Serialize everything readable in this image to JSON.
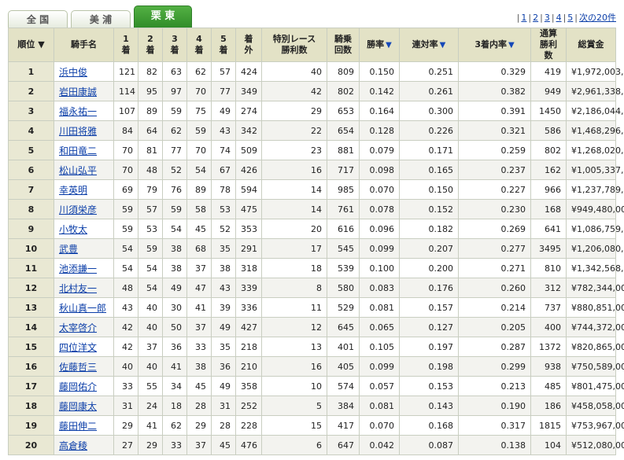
{
  "tabs": [
    {
      "label": "全 国",
      "active": false
    },
    {
      "label": "美 浦",
      "active": false
    },
    {
      "label": "栗 東",
      "active": true
    }
  ],
  "pager": {
    "pages": [
      "1",
      "2",
      "3",
      "4",
      "5"
    ],
    "next_label": "次の20件"
  },
  "colors": {
    "header_bg": "#e3e2c6",
    "tab_active": "#3a9a31",
    "link": "#0b3ea8"
  },
  "table": {
    "headers": {
      "rank": "順位",
      "name": "騎手名",
      "first": "1着",
      "second": "2着",
      "third": "3着",
      "fourth": "4着",
      "fifth": "5着",
      "out": "着外",
      "special_1": "特別レース",
      "special_2": "勝利数",
      "rides_1": "騎乗",
      "rides_2": "回数",
      "win_rate": "勝率",
      "quinella_rate": "連対率",
      "top3_rate": "3着内率",
      "career_1": "通算",
      "career_2": "勝利数",
      "prize": "総賞金"
    },
    "sort_marker": "▼",
    "rows": [
      {
        "rank": "1",
        "name": "浜中俊",
        "first": "121",
        "second": "82",
        "third": "63",
        "fourth": "62",
        "fifth": "57",
        "out": "424",
        "special": "40",
        "rides": "809",
        "win_rate": "0.150",
        "quinella_rate": "0.251",
        "top3_rate": "0.329",
        "career": "419",
        "prize": "¥1,972,003,000"
      },
      {
        "rank": "2",
        "name": "岩田康誠",
        "first": "114",
        "second": "95",
        "third": "97",
        "fourth": "70",
        "fifth": "77",
        "out": "349",
        "special": "42",
        "rides": "802",
        "win_rate": "0.142",
        "quinella_rate": "0.261",
        "top3_rate": "0.382",
        "career": "949",
        "prize": "¥2,961,338,000"
      },
      {
        "rank": "3",
        "name": "福永祐一",
        "first": "107",
        "second": "89",
        "third": "59",
        "fourth": "75",
        "fifth": "49",
        "out": "274",
        "special": "29",
        "rides": "653",
        "win_rate": "0.164",
        "quinella_rate": "0.300",
        "top3_rate": "0.391",
        "career": "1450",
        "prize": "¥2,186,044,000"
      },
      {
        "rank": "4",
        "name": "川田将雅",
        "first": "84",
        "second": "64",
        "third": "62",
        "fourth": "59",
        "fifth": "43",
        "out": "342",
        "special": "22",
        "rides": "654",
        "win_rate": "0.128",
        "quinella_rate": "0.226",
        "top3_rate": "0.321",
        "career": "586",
        "prize": "¥1,468,296,000"
      },
      {
        "rank": "5",
        "name": "和田竜二",
        "first": "70",
        "second": "81",
        "third": "77",
        "fourth": "70",
        "fifth": "74",
        "out": "509",
        "special": "23",
        "rides": "881",
        "win_rate": "0.079",
        "quinella_rate": "0.171",
        "top3_rate": "0.259",
        "career": "802",
        "prize": "¥1,268,020,000"
      },
      {
        "rank": "6",
        "name": "松山弘平",
        "first": "70",
        "second": "48",
        "third": "52",
        "fourth": "54",
        "fifth": "67",
        "out": "426",
        "special": "16",
        "rides": "717",
        "win_rate": "0.098",
        "quinella_rate": "0.165",
        "top3_rate": "0.237",
        "career": "162",
        "prize": "¥1,005,337,000"
      },
      {
        "rank": "7",
        "name": "幸英明",
        "first": "69",
        "second": "79",
        "third": "76",
        "fourth": "89",
        "fifth": "78",
        "out": "594",
        "special": "14",
        "rides": "985",
        "win_rate": "0.070",
        "quinella_rate": "0.150",
        "top3_rate": "0.227",
        "career": "966",
        "prize": "¥1,237,789,000"
      },
      {
        "rank": "8",
        "name": "川須栄彦",
        "first": "59",
        "second": "57",
        "third": "59",
        "fourth": "58",
        "fifth": "53",
        "out": "475",
        "special": "14",
        "rides": "761",
        "win_rate": "0.078",
        "quinella_rate": "0.152",
        "top3_rate": "0.230",
        "career": "168",
        "prize": "¥949,480,000"
      },
      {
        "rank": "9",
        "name": "小牧太",
        "first": "59",
        "second": "53",
        "third": "54",
        "fourth": "45",
        "fifth": "52",
        "out": "353",
        "special": "20",
        "rides": "616",
        "win_rate": "0.096",
        "quinella_rate": "0.182",
        "top3_rate": "0.269",
        "career": "641",
        "prize": "¥1,086,759,000"
      },
      {
        "rank": "10",
        "name": "武豊",
        "first": "54",
        "second": "59",
        "third": "38",
        "fourth": "68",
        "fifth": "35",
        "out": "291",
        "special": "17",
        "rides": "545",
        "win_rate": "0.099",
        "quinella_rate": "0.207",
        "top3_rate": "0.277",
        "career": "3495",
        "prize": "¥1,206,080,000"
      },
      {
        "rank": "11",
        "name": "池添謙一",
        "first": "54",
        "second": "54",
        "third": "38",
        "fourth": "37",
        "fifth": "38",
        "out": "318",
        "special": "18",
        "rides": "539",
        "win_rate": "0.100",
        "quinella_rate": "0.200",
        "top3_rate": "0.271",
        "career": "810",
        "prize": "¥1,342,568,000"
      },
      {
        "rank": "12",
        "name": "北村友一",
        "first": "48",
        "second": "54",
        "third": "49",
        "fourth": "47",
        "fifth": "43",
        "out": "339",
        "special": "8",
        "rides": "580",
        "win_rate": "0.083",
        "quinella_rate": "0.176",
        "top3_rate": "0.260",
        "career": "312",
        "prize": "¥782,344,000"
      },
      {
        "rank": "13",
        "name": "秋山真一郎",
        "first": "43",
        "second": "40",
        "third": "30",
        "fourth": "41",
        "fifth": "39",
        "out": "336",
        "special": "11",
        "rides": "529",
        "win_rate": "0.081",
        "quinella_rate": "0.157",
        "top3_rate": "0.214",
        "career": "737",
        "prize": "¥880,851,000"
      },
      {
        "rank": "14",
        "name": "太宰啓介",
        "first": "42",
        "second": "40",
        "third": "50",
        "fourth": "37",
        "fifth": "49",
        "out": "427",
        "special": "12",
        "rides": "645",
        "win_rate": "0.065",
        "quinella_rate": "0.127",
        "top3_rate": "0.205",
        "career": "400",
        "prize": "¥744,372,000"
      },
      {
        "rank": "15",
        "name": "四位洋文",
        "first": "42",
        "second": "37",
        "third": "36",
        "fourth": "33",
        "fifth": "35",
        "out": "218",
        "special": "13",
        "rides": "401",
        "win_rate": "0.105",
        "quinella_rate": "0.197",
        "top3_rate": "0.287",
        "career": "1372",
        "prize": "¥820,865,000"
      },
      {
        "rank": "16",
        "name": "佐藤哲三",
        "first": "40",
        "second": "40",
        "third": "41",
        "fourth": "38",
        "fifth": "36",
        "out": "210",
        "special": "16",
        "rides": "405",
        "win_rate": "0.099",
        "quinella_rate": "0.198",
        "top3_rate": "0.299",
        "career": "938",
        "prize": "¥750,589,000"
      },
      {
        "rank": "17",
        "name": "藤岡佑介",
        "first": "33",
        "second": "55",
        "third": "34",
        "fourth": "45",
        "fifth": "49",
        "out": "358",
        "special": "10",
        "rides": "574",
        "win_rate": "0.057",
        "quinella_rate": "0.153",
        "top3_rate": "0.213",
        "career": "485",
        "prize": "¥801,475,000"
      },
      {
        "rank": "18",
        "name": "藤岡康太",
        "first": "31",
        "second": "24",
        "third": "18",
        "fourth": "28",
        "fifth": "31",
        "out": "252",
        "special": "5",
        "rides": "384",
        "win_rate": "0.081",
        "quinella_rate": "0.143",
        "top3_rate": "0.190",
        "career": "186",
        "prize": "¥458,058,000"
      },
      {
        "rank": "19",
        "name": "藤田伸二",
        "first": "29",
        "second": "41",
        "third": "62",
        "fourth": "29",
        "fifth": "28",
        "out": "228",
        "special": "15",
        "rides": "417",
        "win_rate": "0.070",
        "quinella_rate": "0.168",
        "top3_rate": "0.317",
        "career": "1815",
        "prize": "¥753,967,000"
      },
      {
        "rank": "20",
        "name": "高倉稜",
        "first": "27",
        "second": "29",
        "third": "33",
        "fourth": "37",
        "fifth": "45",
        "out": "476",
        "special": "6",
        "rides": "647",
        "win_rate": "0.042",
        "quinella_rate": "0.087",
        "top3_rate": "0.138",
        "career": "104",
        "prize": "¥512,080,000"
      }
    ]
  }
}
